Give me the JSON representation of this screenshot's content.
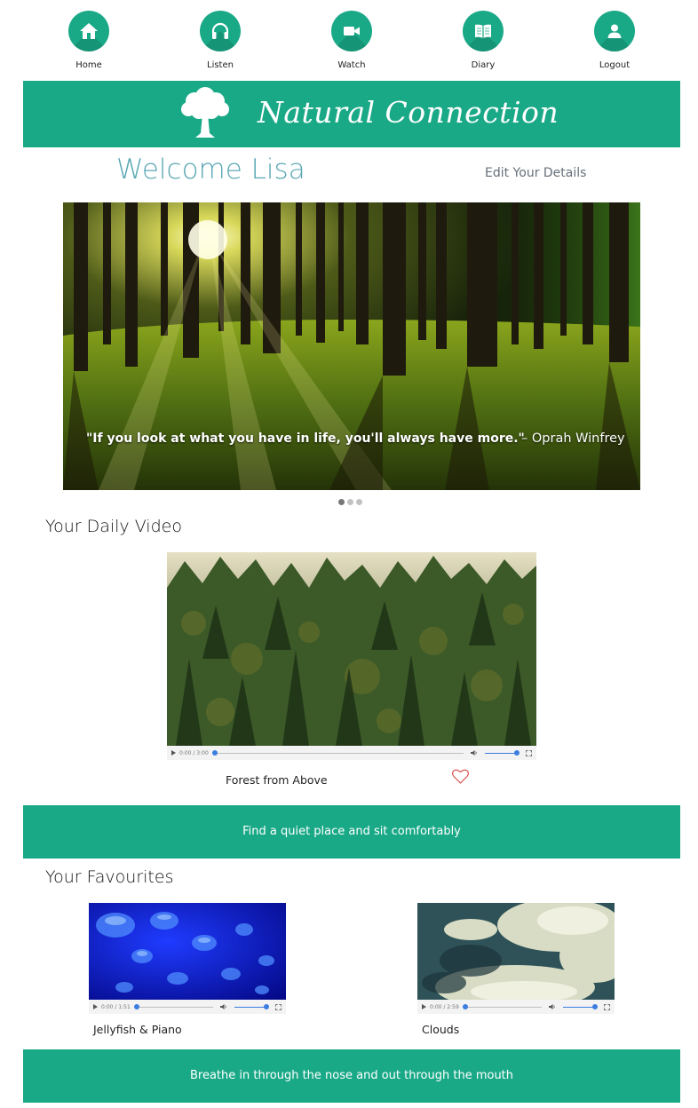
{
  "nav": [
    {
      "label": "Home",
      "icon": "home-icon"
    },
    {
      "label": "Listen",
      "icon": "headphones-icon"
    },
    {
      "label": "Watch",
      "icon": "video-camera-icon"
    },
    {
      "label": "Diary",
      "icon": "book-icon"
    },
    {
      "label": "Logout",
      "icon": "user-icon"
    }
  ],
  "brand": {
    "name": "Natural Connection"
  },
  "welcome": {
    "greeting": "Welcome Lisa",
    "edit_link": "Edit Your Details"
  },
  "slider": {
    "quote": "\"If you look at what you have in life, you'll always have more.\"",
    "author": "– Oprah Winfrey",
    "active_slide": 1,
    "slide_count": 3
  },
  "daily_video": {
    "heading": "Your Daily Video",
    "title": "Forest from Above",
    "time": "0:00 / 3:00"
  },
  "tip1": "Find a quiet place and sit comfortably",
  "favourites": {
    "heading": "Your Favourites",
    "items": [
      {
        "title": "Jellyfish & Piano",
        "time": "0:00 / 1:51"
      },
      {
        "title": "Clouds",
        "time": "0:00 / 2:59"
      }
    ]
  },
  "tip2": "Breathe in through the nose and out through the mouth",
  "colors": {
    "accent": "#1aa987",
    "welcome": "#5ba8b4",
    "heart": "#d9534f"
  }
}
